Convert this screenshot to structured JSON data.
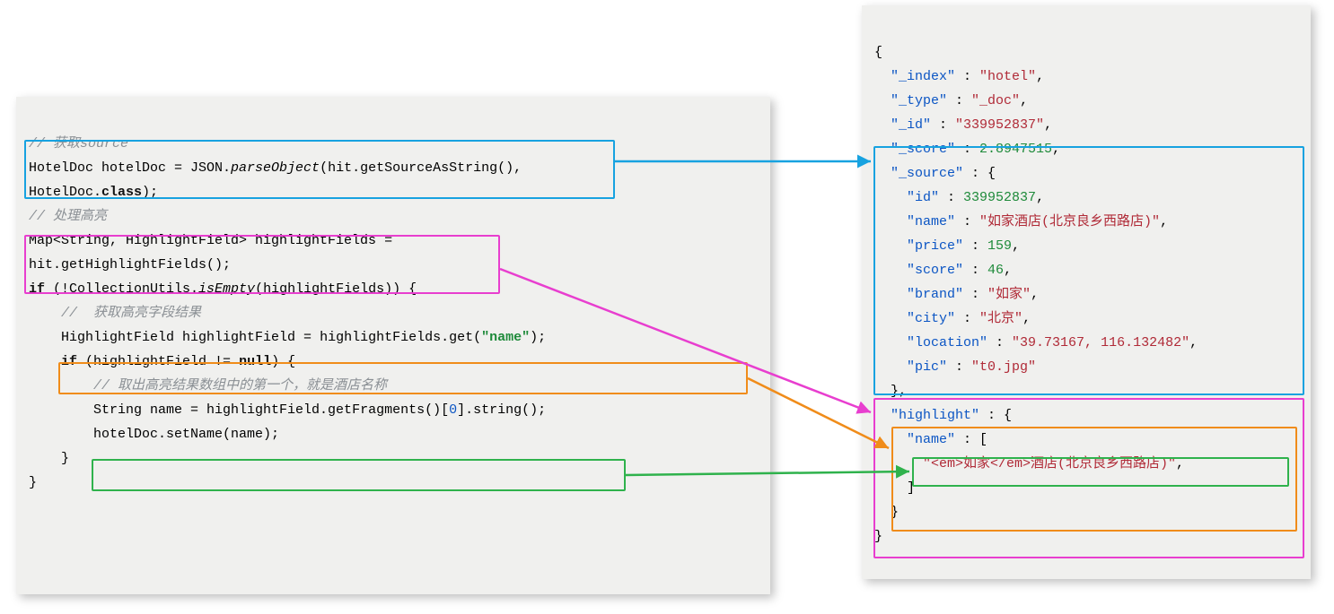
{
  "left": {
    "c1": "// 获取source",
    "l1a": "HotelDoc hotelDoc = JSON.",
    "l1b": "parseObject",
    "l1c": "(hit.getSourceAsString(),",
    "l2a": "HotelDoc.",
    "l2b": "class",
    "l2c": ");",
    "c2": "// 处理高亮",
    "l3": "Map<String, HighlightField> highlightFields =",
    "l4": "hit.getHighlightFields();",
    "l5a": "if",
    "l5b": " (!CollectionUtils.",
    "l5c": "isEmpty",
    "l5d": "(highlightFields)) {",
    "c3": "//  获取高亮字段结果",
    "l6a": "HighlightField highlightField = highlightFields.get(",
    "l6b": "\"name\"",
    "l6c": ");",
    "l7a": "if",
    "l7b": " (highlightField != ",
    "l7c": "null",
    "l7d": ") {",
    "c4": "// 取出高亮结果数组中的第一个，就是酒店名称",
    "l8a": "String name = highlightField.getFragments()[",
    "l8b": "0",
    "l8c": "].string();",
    "l9": "hotelDoc.setName(name);",
    "l10": "}",
    "l11": "}"
  },
  "right": {
    "open": "{",
    "k_index": "\"_index\"",
    "v_index": "\"hotel\"",
    "k_type": "\"_type\"",
    "v_type": "\"_doc\"",
    "k_id": "\"_id\"",
    "v_id": "\"339952837\"",
    "k_score": "\"_score\"",
    "v_score": "2.8947515",
    "k_source": "\"_source\"",
    "k_sid": "\"id\"",
    "v_sid": "339952837",
    "k_name": "\"name\"",
    "v_name": "\"如家酒店(北京良乡西路店)\"",
    "k_price": "\"price\"",
    "v_price": "159",
    "k_sscore": "\"score\"",
    "v_sscore": "46",
    "k_brand": "\"brand\"",
    "v_brand": "\"如家\"",
    "k_city": "\"city\"",
    "v_city": "\"北京\"",
    "k_loc": "\"location\"",
    "v_loc": "\"39.73167, 116.132482\"",
    "k_pic": "\"pic\"",
    "v_pic": "\"t0.jpg\"",
    "close_src": "},",
    "k_hl": "\"highlight\"",
    "k_hname": "\"name\"",
    "v_hl": "\"<em>如家</em>酒店(北京良乡西路店)\"",
    "close_arr": "]",
    "close_hl": "}",
    "close": "}"
  },
  "colors": {
    "blue": "#17a2e0",
    "magenta": "#e83ecf",
    "orange": "#f08c1a",
    "green": "#2fb24c"
  },
  "chart_data": {
    "type": "table",
    "title": "Elasticsearch hit document with highlight",
    "data": {
      "_index": "hotel",
      "_type": "_doc",
      "_id": "339952837",
      "_score": 2.8947515,
      "_source": {
        "id": 339952837,
        "name": "如家酒店(北京良乡西路店)",
        "price": 159,
        "score": 46,
        "brand": "如家",
        "city": "北京",
        "location": "39.73167, 116.132482",
        "pic": "t0.jpg"
      },
      "highlight": {
        "name": [
          "<em>如家</em>酒店(北京良乡西路店)"
        ]
      }
    }
  }
}
